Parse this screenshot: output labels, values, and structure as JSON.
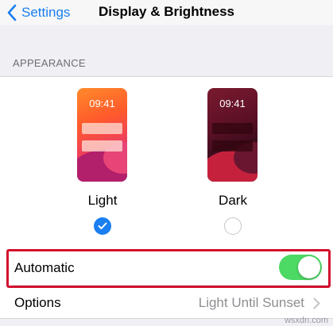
{
  "nav": {
    "back_label": "Settings",
    "title": "Display & Brightness"
  },
  "appearance": {
    "section_header": "APPEARANCE",
    "light": {
      "label": "Light",
      "preview_time": "09:41",
      "selected": true
    },
    "dark": {
      "label": "Dark",
      "preview_time": "09:41",
      "selected": false
    }
  },
  "automatic": {
    "label": "Automatic",
    "toggle_on": true
  },
  "options": {
    "label": "Options",
    "value": "Light Until Sunset"
  },
  "watermark": "wsxdn.com",
  "colors": {
    "accent": "#1a7ff0",
    "toggle_on": "#4cd964",
    "highlight": "#d2102e"
  }
}
